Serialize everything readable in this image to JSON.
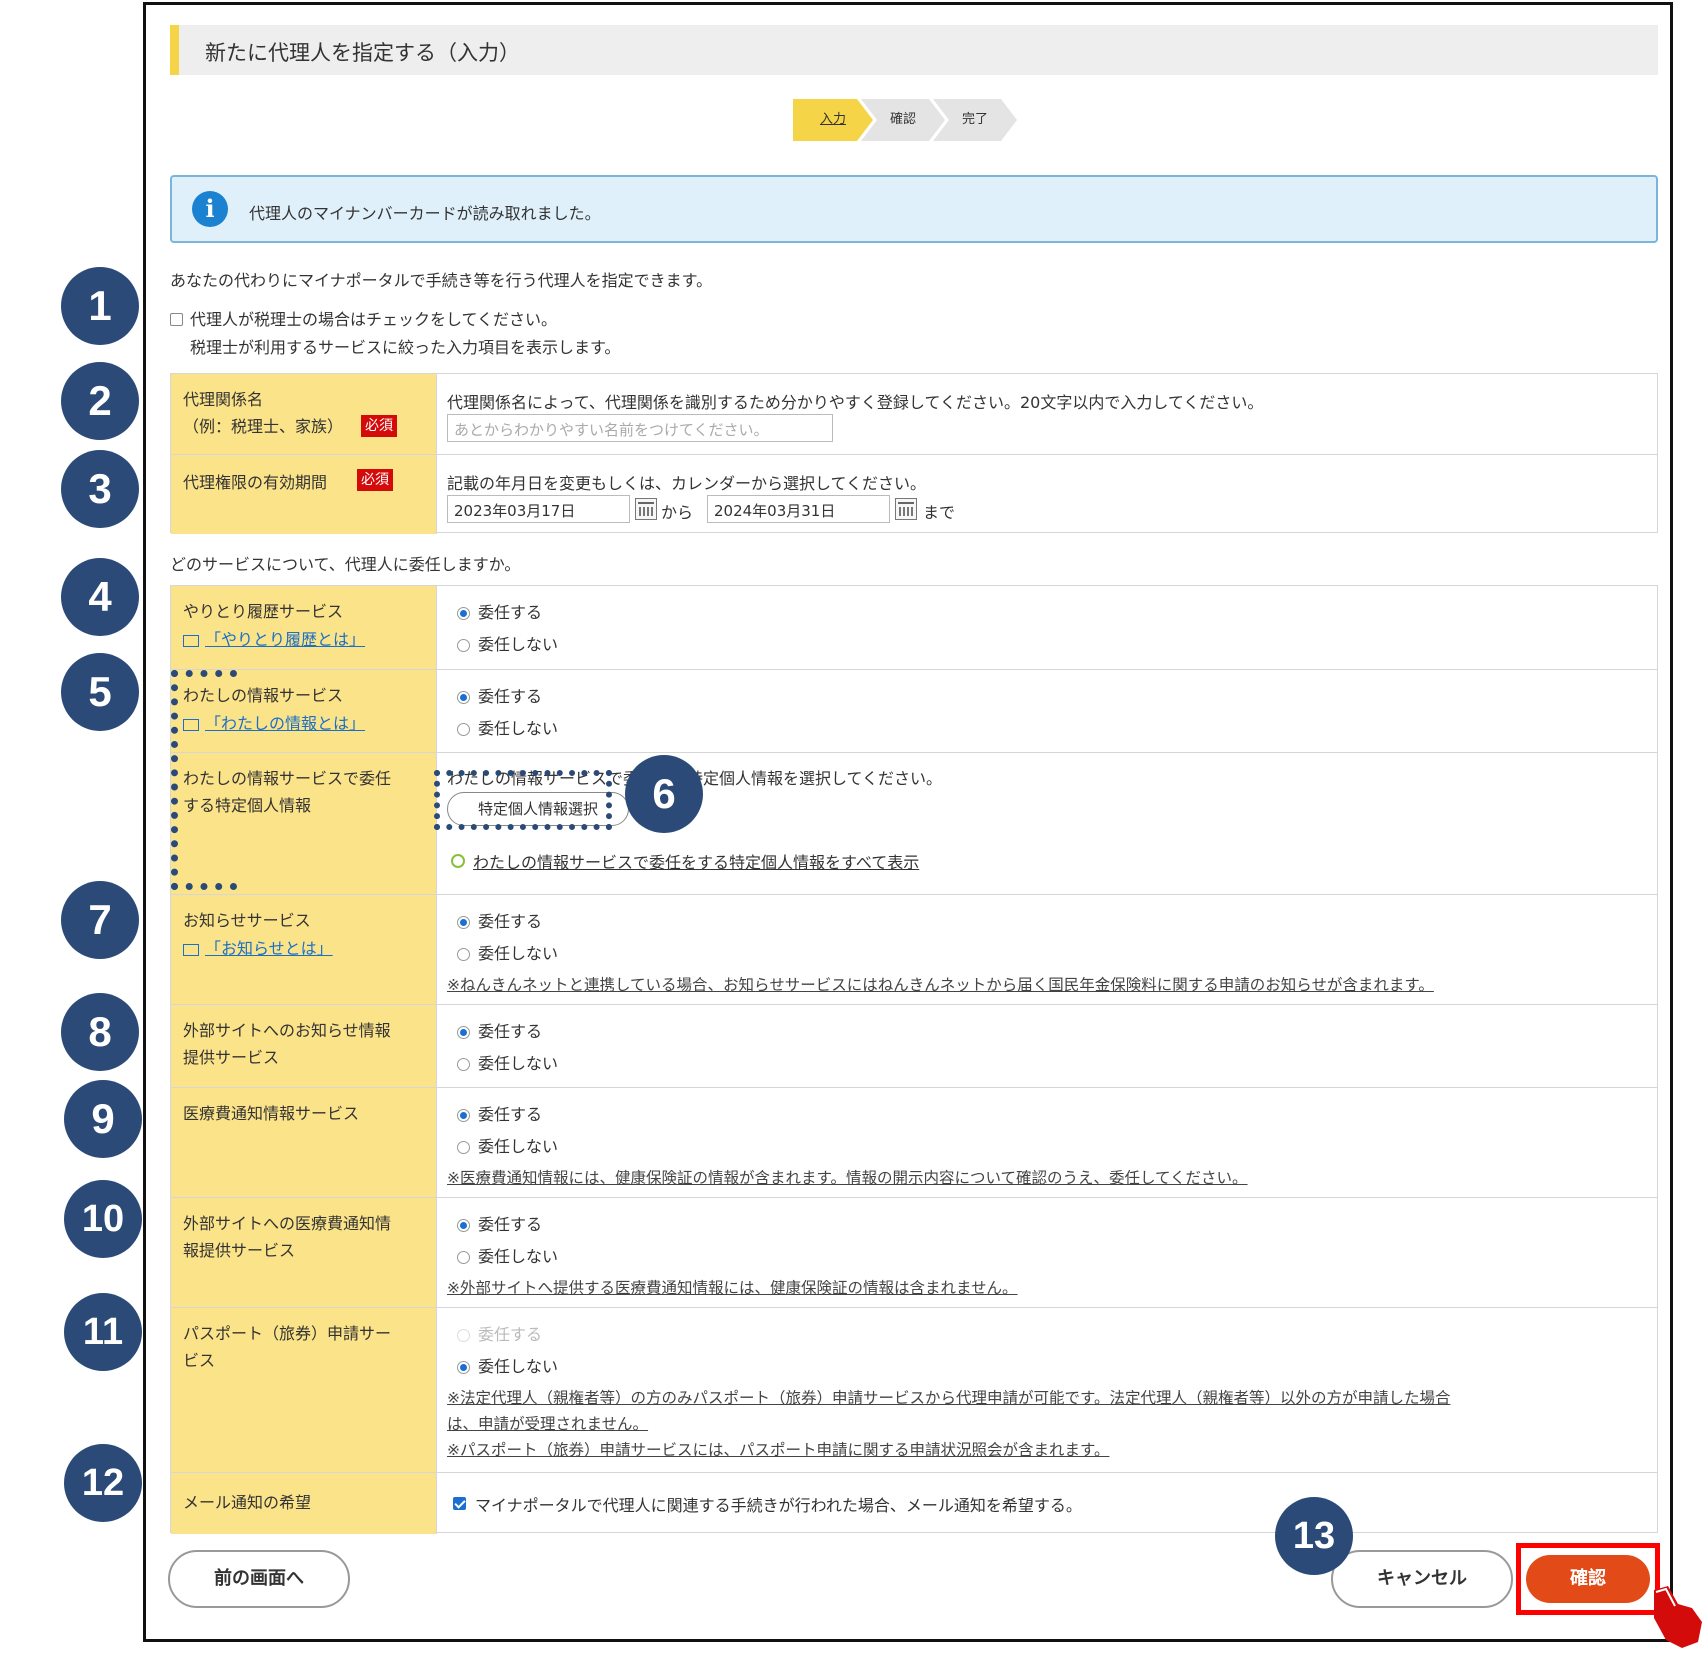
{
  "title": "新たに代理人を指定する（入力）",
  "steps": [
    "入力",
    "確認",
    "完了"
  ],
  "info_message": "代理人のマイナンバーカードが読み取れました。",
  "intro": "あなたの代わりにマイナポータルで手続き等を行う代理人を指定できます。",
  "tax_accountant": {
    "line1": "代理人が税理士の場合はチェックをしてください。",
    "line2": "税理士が利用するサービスに絞った入力項目を表示します。"
  },
  "relation": {
    "label": "代理関係名\n（例：税理士、家族）",
    "required": "必須",
    "description": "代理関係名によって、代理関係を識別するため分かりやすく登録してください。20文字以内で入力してください。",
    "placeholder": "あとからわかりやすい名前をつけてください。"
  },
  "period": {
    "label": "代理権限の有効期間",
    "required": "必須",
    "description": "記載の年月日を変更もしくは、カレンダーから選択してください。",
    "start": "2023年03月17日",
    "from": "から",
    "end": "2024年03月31日",
    "until": "まで"
  },
  "services_question": "どのサービスについて、代理人に委任しますか。",
  "options": {
    "delegate": "委任する",
    "not_delegate": "委任しない"
  },
  "services": {
    "history": {
      "label": "やりとり履歴サービス",
      "link": "「やりとり履歴とは」",
      "selected": "delegate"
    },
    "myinfo": {
      "label": "わたしの情報サービス",
      "link": "「わたしの情報とは」",
      "selected": "delegate"
    },
    "myinfo_specific": {
      "label": "わたしの情報サービスで委任\nする特定個人情報",
      "description": "わたしの情報サービスで委任する特定個人情報を選択してください。",
      "button": "特定個人情報選択",
      "show_all": "わたしの情報サービスで委任をする特定個人情報をすべて表示"
    },
    "notice": {
      "label": "お知らせサービス",
      "link": "「お知らせとは」",
      "selected": "delegate",
      "note": "※ねんきんネットと連携している場合、お知らせサービスにはねんきんネットから届く国民年金保険料に関する申請のお知らせが含まれます。"
    },
    "external_notice": {
      "label": "外部サイトへのお知らせ情報\n提供サービス",
      "selected": "delegate"
    },
    "medical": {
      "label": "医療費通知情報サービス",
      "selected": "delegate",
      "note": "※医療費通知情報には、健康保険証の情報が含まれます。情報の開示内容について確認のうえ、委任してください。"
    },
    "external_medical": {
      "label": "外部サイトへの医療費通知情\n報提供サービス",
      "selected": "delegate",
      "note": "※外部サイトへ提供する医療費通知情報には、健康保険証の情報は含まれません。"
    },
    "passport": {
      "label": "パスポート（旅券）申請サー\nビス",
      "selected": "not_delegate",
      "note1": "※法定代理人（親権者等）の方のみパスポート（旅券）申請サービスから代理申請が可能です。法定代理人（親権者等）以外の方が申請した場合",
      "note2": "は、申請が受理されません。",
      "note3": "※パスポート（旅券）申請サービスには、パスポート申請に関する申請状況照会が含まれます。"
    }
  },
  "mail": {
    "label": "メール通知の希望",
    "text": "マイナポータルで代理人に関連する手続きが行われた場合、メール通知を希望する。",
    "checked": true
  },
  "buttons": {
    "back": "前の画面へ",
    "cancel": "キャンセル",
    "confirm": "確認"
  },
  "markers": [
    "1",
    "2",
    "3",
    "4",
    "5",
    "6",
    "7",
    "8",
    "9",
    "10",
    "11",
    "12",
    "13"
  ],
  "colors": {
    "header_cell": "#fbe38a",
    "accent": "#f5d547",
    "confirm": "#e24a18",
    "marker": "#2b4a78",
    "highlight": "#ff0000"
  }
}
